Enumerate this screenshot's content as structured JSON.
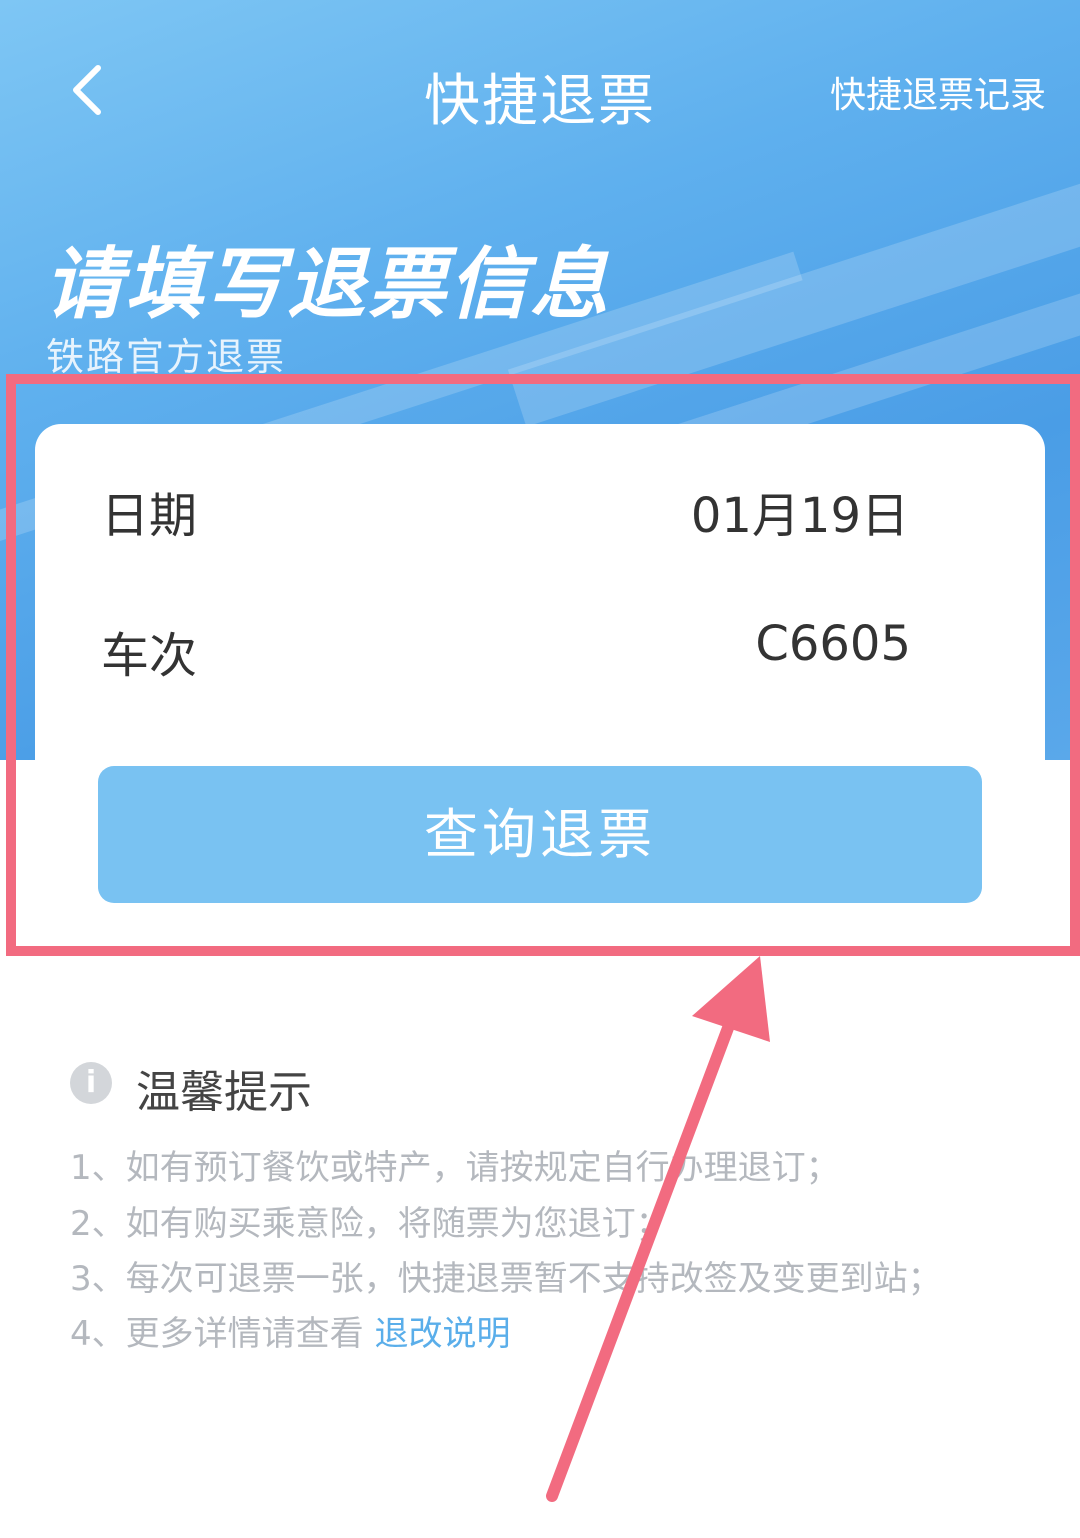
{
  "nav": {
    "title": "快捷退票",
    "records_link": "快捷退票记录"
  },
  "hero": {
    "heading": "请填写退票信息",
    "subheading": "铁路官方退票"
  },
  "form": {
    "date_label": "日期",
    "date_value": "01月19日",
    "train_label": "车次",
    "train_value": "C6605",
    "query_button": "查询退票"
  },
  "tips": {
    "title": "温馨提示",
    "items": [
      "1、如有预订餐饮或特产，请按规定自行办理退订；",
      "2、如有购买乘意险，将随票为您退订；",
      "3、每次可退票一张，快捷退票暂不支持改签及变更到站；",
      "4、更多详情请查看"
    ],
    "link_text": "退改说明"
  },
  "annotation": {
    "color": "#f26b80",
    "icons": [
      "back-chevron-icon",
      "info-icon",
      "annotation-arrow"
    ]
  }
}
